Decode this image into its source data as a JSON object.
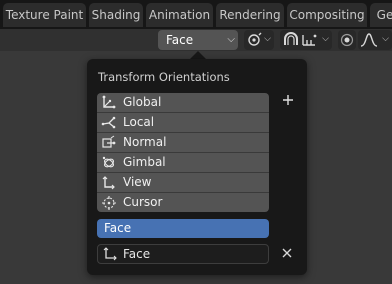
{
  "tabs": [
    "Texture Paint",
    "Shading",
    "Animation",
    "Rendering",
    "Compositing",
    "Ge"
  ],
  "header": {
    "orientation_value": "Face"
  },
  "popover": {
    "title": "Transform Orientations",
    "orientations": [
      {
        "label": "Global",
        "icon": "orientation-global-icon"
      },
      {
        "label": "Local",
        "icon": "orientation-local-icon"
      },
      {
        "label": "Normal",
        "icon": "orientation-normal-icon"
      },
      {
        "label": "Gimbal",
        "icon": "orientation-gimbal-icon"
      },
      {
        "label": "View",
        "icon": "orientation-view-icon"
      },
      {
        "label": "Cursor",
        "icon": "orientation-cursor-icon"
      }
    ],
    "custom_selected": "Face",
    "name_value": "Face"
  },
  "colors": {
    "accent": "#4772b3",
    "background": "#393939",
    "popover": "#181818",
    "list_item": "#545454"
  }
}
